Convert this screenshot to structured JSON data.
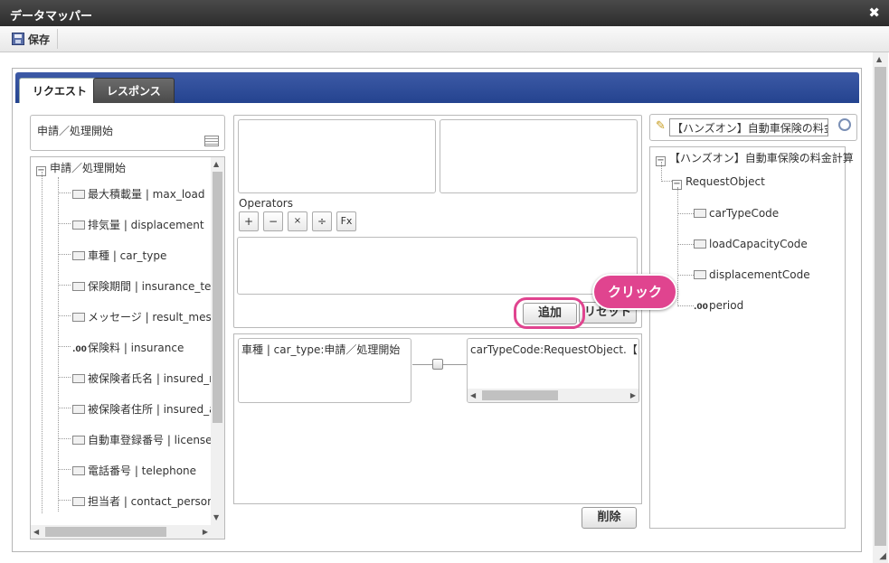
{
  "window": {
    "title": "データマッパー"
  },
  "toolbar": {
    "save_label": "保存"
  },
  "tabs": [
    {
      "label": "リクエスト",
      "active": true
    },
    {
      "label": "レスポンス",
      "active": false
    }
  ],
  "source": {
    "header": "申請／処理開始",
    "root": "申請／処理開始",
    "items": [
      {
        "label": "最大積載量 | max_load",
        "type": "field"
      },
      {
        "label": "排気量 | displacement",
        "type": "field"
      },
      {
        "label": "車種 | car_type",
        "type": "field"
      },
      {
        "label": "保険期間 | insurance_term",
        "type": "field"
      },
      {
        "label": "メッセージ | result_message",
        "type": "field"
      },
      {
        "label": "保険料 | insurance",
        "type": "number"
      },
      {
        "label": "被保険者氏名 | insured_name",
        "type": "field"
      },
      {
        "label": "被保険者住所 | insured_address",
        "type": "field"
      },
      {
        "label": "自動車登録番号 | license_number",
        "type": "field"
      },
      {
        "label": "電話番号 | telephone",
        "type": "field"
      },
      {
        "label": "担当者 | contact_personnel",
        "type": "field"
      }
    ]
  },
  "operators": {
    "label": "Operators",
    "buttons": [
      "+",
      "−",
      "×",
      "÷",
      "Fx"
    ]
  },
  "buttons": {
    "add": "追加",
    "reset": "リセット",
    "delete": "削除"
  },
  "callout": "クリック",
  "mapping": {
    "left": "車種 | car_type:申請／処理開始",
    "right": "carTypeCode:RequestObject.【ハンズオン】自動車保険の料金計算"
  },
  "target": {
    "search_value": "【ハンズオン】自動車保険の料金計算",
    "root": "【ハンズオン】自動車保険の料金計算",
    "object": "RequestObject",
    "items": [
      {
        "label": "carTypeCode",
        "type": "field"
      },
      {
        "label": "loadCapacityCode",
        "type": "field"
      },
      {
        "label": "displacementCode",
        "type": "field"
      },
      {
        "label": "period",
        "type": "number"
      }
    ]
  },
  "icons": {
    "close": "close-icon",
    "save": "save-disk-icon",
    "search": "magnifier-icon",
    "edit": "pencil-icon"
  },
  "colors": {
    "tab_bar": "#24438f",
    "highlight": "#e0448f"
  }
}
